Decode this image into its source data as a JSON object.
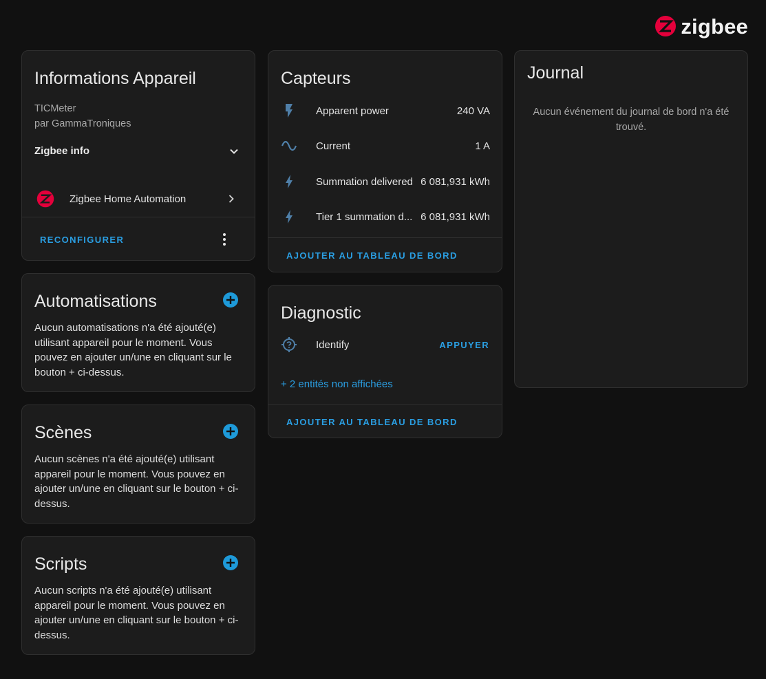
{
  "logo": {
    "text": "zigbee",
    "brand_color": "#e4003b"
  },
  "device_info": {
    "title": "Informations Appareil",
    "model": "TICMeter",
    "manufacturer": "par GammaTroniques",
    "zigbee_info_label": "Zigbee info",
    "integration_label": "Zigbee Home Automation",
    "reconfigure_label": "RECONFIGURER"
  },
  "automations": {
    "title": "Automatisations",
    "empty_text": "Aucun automatisations n'a été ajouté(e) utilisant appareil pour le moment. Vous pouvez en ajouter un/une en cliquant sur le bouton + ci-dessus."
  },
  "scenes": {
    "title": "Scènes",
    "empty_text": "Aucun scènes n'a été ajouté(e) utilisant appareil pour le moment. Vous pouvez en ajouter un/une en cliquant sur le bouton + ci-dessus."
  },
  "scripts": {
    "title": "Scripts",
    "empty_text": "Aucun scripts n'a été ajouté(e) utilisant appareil pour le moment. Vous pouvez en ajouter un/une en cliquant sur le bouton + ci-dessus."
  },
  "sensors": {
    "title": "Capteurs",
    "items": [
      {
        "icon": "flash-icon",
        "name": "Apparent power",
        "value": "240 VA"
      },
      {
        "icon": "sine-wave-icon",
        "name": "Current",
        "value": "1 A"
      },
      {
        "icon": "flash-icon",
        "name": "Summation delivered",
        "value": "6 081,931 kWh"
      },
      {
        "icon": "flash-icon",
        "name": "Tier 1 summation d...",
        "value": "6 081,931 kWh"
      }
    ],
    "add_dashboard_label": "AJOUTER AU TABLEAU DE BORD"
  },
  "diagnostic": {
    "title": "Diagnostic",
    "identify_label": "Identify",
    "identify_action": "APPUYER",
    "hidden_entities": "+ 2 entités non affichées",
    "add_dashboard_label": "AJOUTER AU TABLEAU DE BORD"
  },
  "logbook": {
    "title": "Journal",
    "empty_text": "Aucun événement du journal de bord n'a été trouvé."
  },
  "colors": {
    "accent": "#2a9ee2",
    "card_bg": "#1c1c1c",
    "page_bg": "#111111",
    "icon": "#4f7fa8"
  }
}
